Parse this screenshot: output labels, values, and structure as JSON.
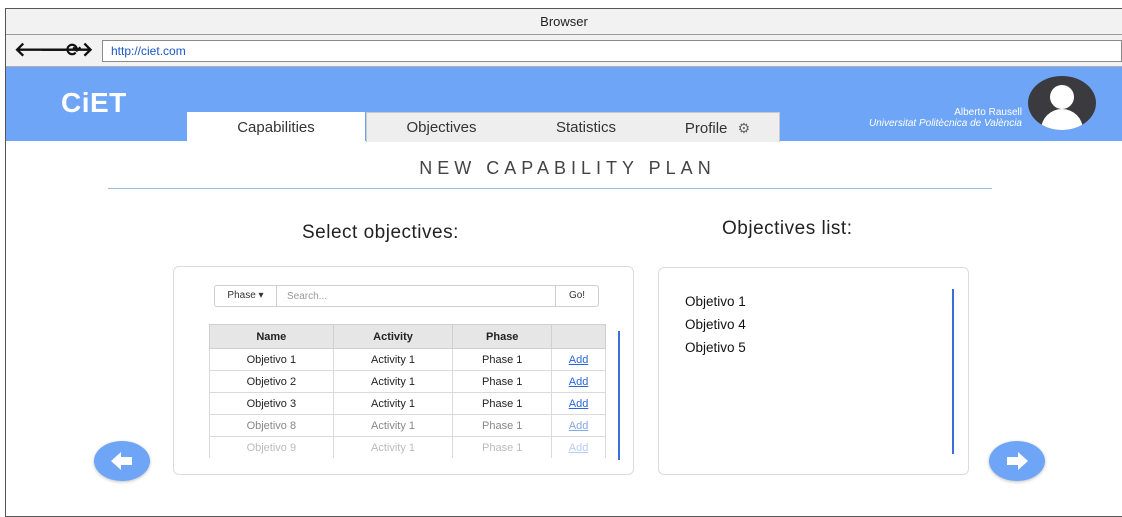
{
  "browser": {
    "title": "Browser",
    "url": "http://ciet.com",
    "back_glyph": "🡐",
    "forward_glyph": "🡒",
    "reload_glyph": "⟳"
  },
  "app": {
    "logo": "CiET",
    "accent_color": "#6ea5f7",
    "tabs": [
      {
        "label": "Capabilities",
        "active": true
      },
      {
        "label": "Objectives",
        "active": false
      },
      {
        "label": "Statistics",
        "active": false
      },
      {
        "label": "Profile",
        "active": false,
        "icon": "gears-icon"
      }
    ],
    "user": {
      "name": "Alberto Rausell",
      "organization": "Universitat Politècnica de València"
    }
  },
  "page": {
    "title": "NEW CAPABILITY PLAN",
    "select_heading": "Select objectives:",
    "list_heading": "Objectives list:"
  },
  "filter": {
    "dropdown_label": "Phase ▾",
    "search_placeholder": "Search...",
    "go_label": "Go!"
  },
  "table": {
    "columns": [
      "Name",
      "Activity",
      "Phase",
      ""
    ],
    "rows": [
      {
        "name": "Objetivo 1",
        "activity": "Activity 1",
        "phase": "Phase 1",
        "action": "Add"
      },
      {
        "name": "Objetivo 2",
        "activity": "Activity 1",
        "phase": "Phase 1",
        "action": "Add"
      },
      {
        "name": "Objetivo 3",
        "activity": "Activity 1",
        "phase": "Phase 1",
        "action": "Add"
      },
      {
        "name": "Objetivo 8",
        "activity": "Activity 1",
        "phase": "Phase 1",
        "action": "Add"
      },
      {
        "name": "Objetivo 9",
        "activity": "Activity 1",
        "phase": "Phase 1",
        "action": "Add"
      }
    ]
  },
  "objectives_list": [
    "Objetivo 1",
    "Objetivo 4",
    "Objetivo 5"
  ]
}
